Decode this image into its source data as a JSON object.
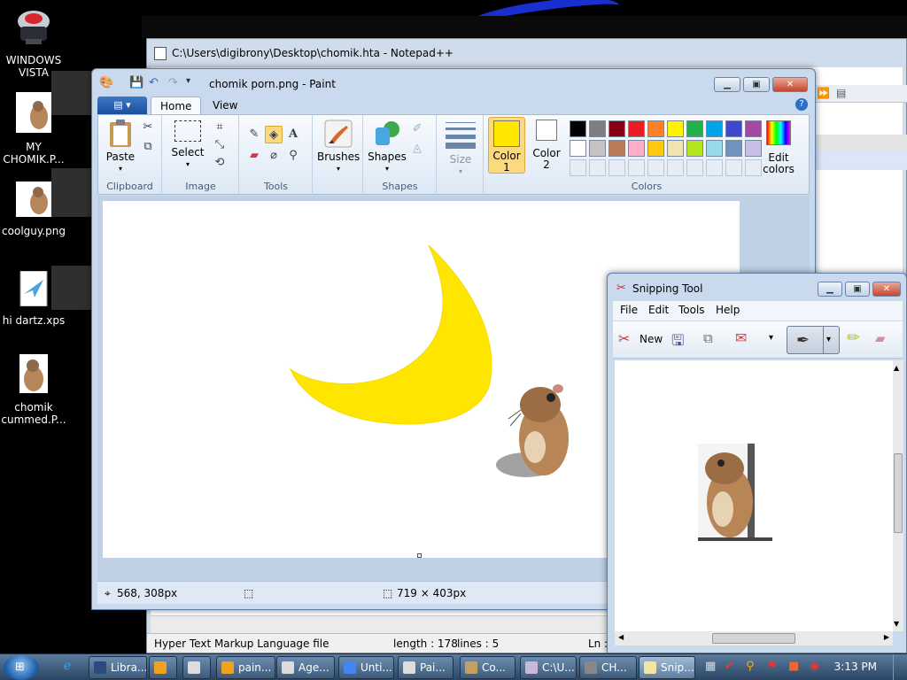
{
  "desktop": {
    "icons": [
      {
        "label": "WINDOWS VISTA"
      },
      {
        "label": "MY CHOMIK.P..."
      },
      {
        "label": "coolguy.png"
      },
      {
        "label": "hi dartz.xps"
      },
      {
        "label": "chomik cummed.P..."
      }
    ]
  },
  "notepadpp": {
    "title": "C:\\Users\\digibrony\\Desktop\\chomik.hta - Notepad++",
    "status": {
      "filetype": "Hyper Text Markup Language file",
      "length": "length : 178",
      "lines": "lines : 5",
      "ln": "Ln :"
    }
  },
  "paint": {
    "title": "chomik porn.png - Paint",
    "tabs": [
      "Home",
      "View"
    ],
    "groups": {
      "clipboard": "Clipboard",
      "image": "Image",
      "tools": "Tools",
      "shapes": "Shapes",
      "colors": "Colors"
    },
    "buttons": {
      "paste": "Paste",
      "select": "Select",
      "brushes": "Brushes",
      "shapes": "Shapes",
      "size": "Size",
      "color1_a": "Color",
      "color1_b": "1",
      "color2_a": "Color",
      "color2_b": "2",
      "edit_colors_a": "Edit",
      "edit_colors_b": "colors"
    },
    "color1": "#ffe600",
    "color2": "#ffffff",
    "palette_row1": [
      "#000000",
      "#7f7f7f",
      "#880015",
      "#ed1c24",
      "#ff7f27",
      "#fff200",
      "#22b14c",
      "#00a2e8",
      "#3f48cc",
      "#a349a4"
    ],
    "palette_row2": [
      "#ffffff",
      "#c3c3c3",
      "#b97a57",
      "#ffaec9",
      "#ffc90e",
      "#efe4b0",
      "#b5e61d",
      "#99d9ea",
      "#7092be",
      "#c8bfe7"
    ],
    "status": {
      "cursor_pos": "568, 308px",
      "image_size": "719 × 403px"
    }
  },
  "snipping": {
    "title": "Snipping Tool",
    "menu": [
      "File",
      "Edit",
      "Tools",
      "Help"
    ],
    "new_label": "New"
  },
  "taskbar": {
    "items": [
      "Libra...",
      "pain...",
      "Age...",
      "Unti...",
      "Pai...",
      "Co...",
      "C:\\U...",
      "CH...",
      "Snip..."
    ],
    "clock": "3:13 PM"
  }
}
